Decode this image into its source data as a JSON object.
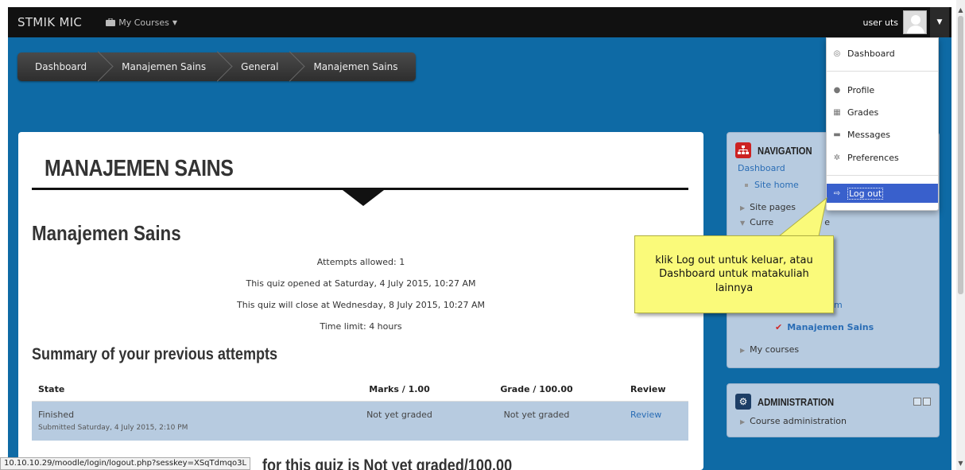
{
  "navbar": {
    "brand": "STMIK MIC",
    "my_courses": "My Courses",
    "username": "user uts"
  },
  "breadcrumb": [
    "Dashboard",
    "Manajemen Sains",
    "General",
    "Manajemen Sains"
  ],
  "main": {
    "course_heading": "MANAJEMEN SAINS",
    "quiz_title": "Manajemen Sains",
    "info": [
      "Attempts allowed: 1",
      "This quiz opened at Saturday, 4 July 2015, 10:27 AM",
      "This quiz will close at Wednesday, 8 July 2015, 10:27 AM",
      "Time limit: 4 hours"
    ],
    "summary_title": "Summary of your previous attempts",
    "table": {
      "headers": [
        "State",
        "Marks / 1.00",
        "Grade / 100.00",
        "Review"
      ],
      "rows": [
        {
          "state": "Finished",
          "submitted": "Submitted Saturday, 4 July 2015, 2:10 PM",
          "marks": "Not yet graded",
          "grade": "Not yet graded",
          "review": "Review"
        }
      ]
    },
    "final_grade_visible": "for this quiz is Not yet graded/100.00"
  },
  "status_url": "10.10.10.29/moodle/login/logout.php?sesskey=XSqTdmqo3L",
  "navigation": {
    "title": "NAVIGATION",
    "dashboard": "Dashboard",
    "site_home": "Site home",
    "site_pages": "Site pages",
    "current_course_partial": "Curre",
    "current_course_tail": "e",
    "hidden_item_tail": "m",
    "current_quiz": "Manajemen Sains",
    "my_courses": "My courses"
  },
  "administration": {
    "title": "ADMINISTRATION",
    "course_admin": "Course administration"
  },
  "dropdown": {
    "items": [
      {
        "label": "Dashboard",
        "icon": "dashboard-icon"
      },
      {
        "label": "Profile",
        "icon": "user-icon"
      },
      {
        "label": "Grades",
        "icon": "grades-icon"
      },
      {
        "label": "Messages",
        "icon": "messages-icon"
      },
      {
        "label": "Preferences",
        "icon": "gear-icon"
      },
      {
        "label": "Log out",
        "icon": "logout-icon"
      }
    ]
  },
  "callout": {
    "text": "klik Log out untuk keluar, atau Dashboard untuk matakuliah lainnya"
  },
  "colors": {
    "page_blue": "#0e6aa5",
    "navbar": "#111111",
    "block_bg": "#b7cbe0",
    "active_menu": "#3960cc",
    "callout": "#fafa7a"
  }
}
